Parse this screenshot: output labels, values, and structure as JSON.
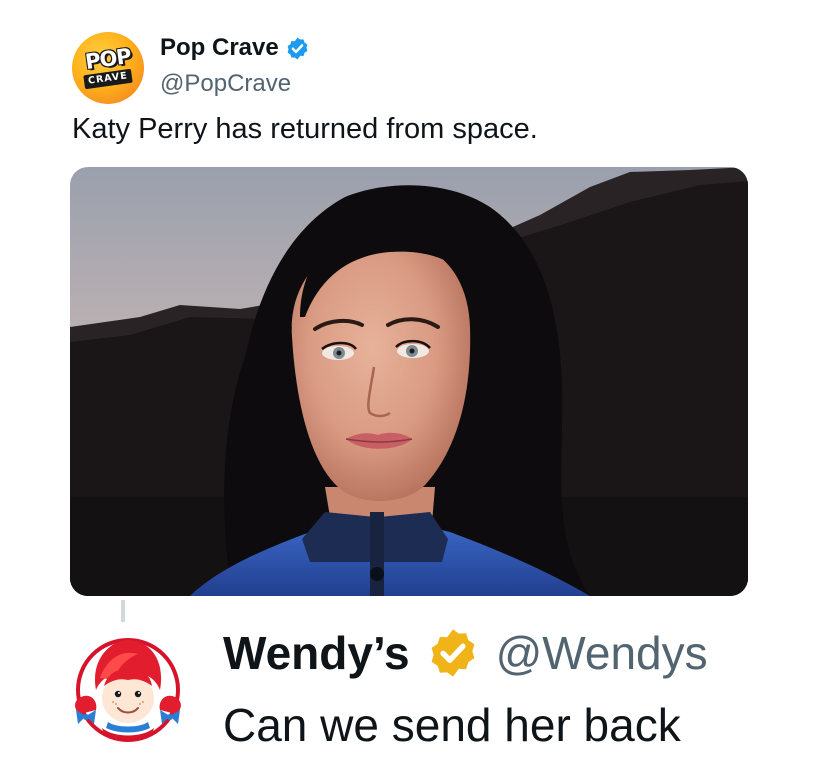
{
  "tweet": {
    "author": {
      "name": "Pop Crave",
      "handle": "@PopCrave",
      "avatar_word_top": "POP",
      "avatar_word_bottom": "CRAVE",
      "verified_color": "#1d9bf0"
    },
    "text": "Katy Perry has returned from space.",
    "media": {
      "icon": "photo-of-woman-in-desert",
      "colors": {
        "sky": "#c9b8b5",
        "mountains": "#1a1617",
        "hair": "#0d0b0d",
        "jacket": "#2b57b4"
      }
    }
  },
  "reply": {
    "author": {
      "name": "Wendy’s",
      "handle": "@Wendys",
      "avatar_icon": "wendys-logo",
      "verified_color": "#f0b419"
    },
    "text": "Can we send her back"
  }
}
